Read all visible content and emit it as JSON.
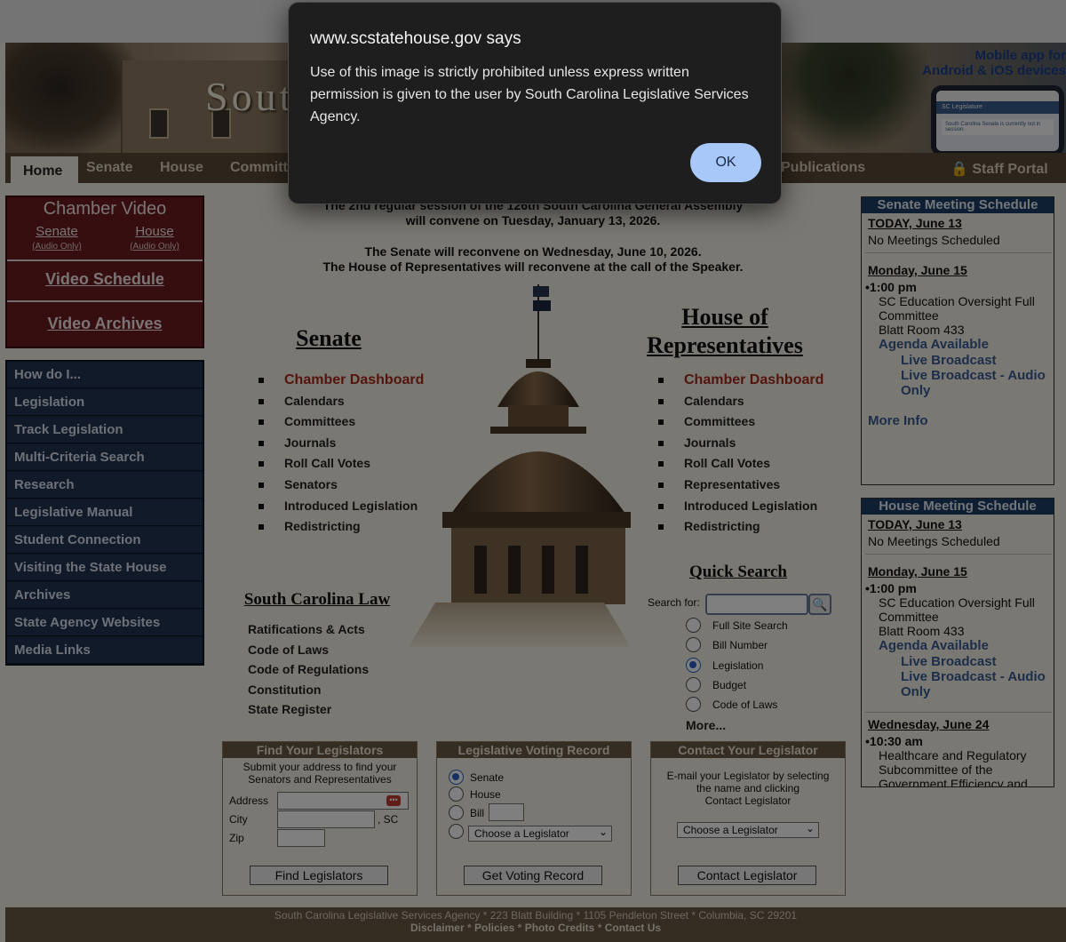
{
  "banner": {
    "title": "South Carolina Legislature",
    "mobile_line1": "Mobile app for",
    "mobile_line2": "Android & iOS devices",
    "phone_header": "SC Legislature",
    "phone_note": "South Carolina Senate is currently not in session."
  },
  "nav": {
    "tabs": [
      "Home",
      "Senate",
      "House",
      "Committees",
      "Publications"
    ],
    "staff_portal": "Staff Portal"
  },
  "video": {
    "title": "Chamber Video",
    "senate": "Senate",
    "house": "House",
    "audio_only": "(Audio Only)",
    "schedule": "Video Schedule",
    "archives": "Video Archives"
  },
  "side_menu": [
    "How do I...",
    "Legislation",
    "Track Legislation",
    "Multi-Criteria Search",
    "Research",
    "Legislative Manual",
    "Student Connection",
    "Visiting the State House",
    "Archives",
    "State Agency Websites",
    "Media Links"
  ],
  "announcement": {
    "line1": "The 2nd regular session of the 126th South Carolina General Assembly",
    "line2": "will convene on Tuesday, January 13, 2026.",
    "line3": "The Senate will reconvene on Wednesday, June 10, 2026.",
    "line4": "The House of Representatives will reconvene at the call of the Speaker."
  },
  "senate": {
    "heading": "Senate",
    "links": [
      "Chamber Dashboard",
      "Calendars",
      "Committees",
      "Journals",
      "Roll Call Votes",
      "Senators",
      "Introduced Legislation",
      "Redistricting"
    ]
  },
  "house": {
    "heading_line1": "House of",
    "heading_line2": "Representatives",
    "links": [
      "Chamber Dashboard",
      "Calendars",
      "Committees",
      "Journals",
      "Roll Call Votes",
      "Representatives",
      "Introduced Legislation",
      "Redistricting"
    ]
  },
  "law": {
    "heading": "South Carolina Law",
    "links": [
      "Ratifications & Acts",
      "Code of Laws",
      "Code of Regulations",
      "Constitution",
      "State Register"
    ]
  },
  "quick_search": {
    "heading": "Quick Search",
    "label": "Search for:",
    "value": "",
    "options": [
      "Full Site Search",
      "Bill Number",
      "Legislation",
      "Budget",
      "Code of Laws"
    ],
    "selected": "Legislation",
    "more": "More..."
  },
  "find_legislators": {
    "title": "Find Your Legislators",
    "desc_line1": "Submit your address to find your",
    "desc_line2": "Senators and Representatives",
    "address_label": "Address",
    "city_label": "City",
    "state": ", SC",
    "zip_label": "Zip",
    "button": "Find Legislators"
  },
  "voting_record": {
    "title": "Legislative Voting Record",
    "options": [
      "Senate",
      "House",
      "Bill"
    ],
    "selected": "Senate",
    "select_value": "Choose a Legislator",
    "button": "Get Voting Record"
  },
  "contact": {
    "title": "Contact Your Legislator",
    "desc_line1": "E-mail your Legislator by selecting",
    "desc_line2": "the name and clicking",
    "desc_line3": "Contact Legislator",
    "select_value": "Choose a Legislator",
    "button": "Contact Legislator"
  },
  "senate_schedule": {
    "title": "Senate Meeting Schedule",
    "today": "TODAY, June 13",
    "no_meetings": "No Meetings Scheduled",
    "day": "Monday, June 15",
    "time": "•1:00 pm",
    "meeting_line1": "SC Education Oversight Full",
    "meeting_line2": "Committee",
    "room": "Blatt Room 433",
    "agenda": "Agenda Available",
    "broadcast": "Live Broadcast",
    "audio_line1": "Live Broadcast - Audio",
    "audio_line2": "Only",
    "more": "More Info"
  },
  "house_schedule": {
    "title": "House Meeting Schedule",
    "today": "TODAY, June 13",
    "no_meetings": "No Meetings Scheduled",
    "day": "Monday, June 15",
    "time": "•1:00 pm",
    "meeting_line1": "SC Education Oversight Full",
    "meeting_line2": "Committee",
    "room": "Blatt Room 433",
    "agenda": "Agenda Available",
    "broadcast": "Live Broadcast",
    "audio_line1": "Live Broadcast - Audio",
    "audio_line2": "Only",
    "day2": "Wednesday, June 24",
    "time2": "•10:30 am",
    "meeting2_line1": "Healthcare and Regulatory",
    "meeting2_line2": "Subcommittee of the",
    "meeting2_line3": "Government Efficiency and"
  },
  "footer": {
    "address": "South Carolina Legislative Services Agency * 223 Blatt Building * 1105 Pendleton Street * Columbia, SC 29201",
    "links": [
      "Disclaimer",
      "Policies",
      "Photo Credits",
      "Contact Us"
    ]
  },
  "dialog": {
    "title": "www.scstatehouse.gov says",
    "message": "Use of this image is strictly prohibited unless express written permission is given to the user by South Carolina Legislative Services Agency.",
    "ok": "OK"
  },
  "colors": {
    "nav_brown": "#5b4a36",
    "video_maroon": "#6e1c20",
    "menu_navy": "#223452",
    "link_red": "#a9281d",
    "link_blue": "#3a5c95",
    "dialog_ok": "#a8c8fa"
  }
}
